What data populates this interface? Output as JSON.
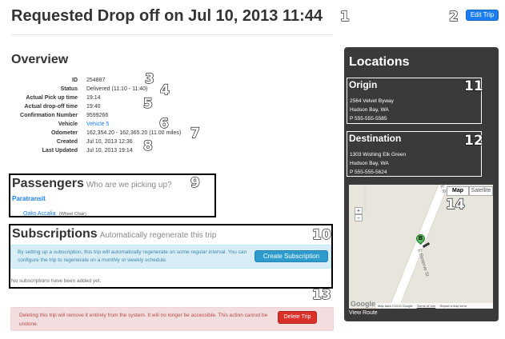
{
  "header": {
    "title": "Requested Drop off on Jul 10, 2013 11:44",
    "edit_trip_label": "Edit Trip"
  },
  "overview": {
    "heading": "Overview",
    "fields": [
      {
        "label": "ID",
        "value": "254887"
      },
      {
        "label": "Status",
        "value": "Delivered (11:10 - 11:40)"
      },
      {
        "label": "Actual Pick up time",
        "value": "19:14"
      },
      {
        "label": "Actual drop-off time",
        "value": "19:40"
      },
      {
        "label": "Confirmation Number",
        "value": "9599266"
      },
      {
        "label": "Vehicle",
        "value": "Vehicle 5"
      },
      {
        "label": "Odometer",
        "value": "162,354.20 - 162,365.20 (11.00 miles)"
      },
      {
        "label": "Created",
        "value": "Jul 10, 2013 12:36"
      },
      {
        "label": "Last Updated",
        "value": "Jul 10, 2013 19:14"
      }
    ]
  },
  "passengers": {
    "heading": "Passengers",
    "subheading": "Who are we picking up?",
    "group": "Paratransit",
    "name": "Oaks Accalia",
    "note": "(Wheel Chair)"
  },
  "subscriptions": {
    "heading": "Subscriptions",
    "subheading": "Automatically regenerate this trip",
    "info": "By setting up a subscription, this trip will automatically regenerate on some regular interval. You can configure the trip to regenerate on a monthly or weekly schedule.",
    "create_label": "Create Subscription",
    "empty_text": "No subscriptions have been added yet."
  },
  "danger": {
    "text": "Deleting this trip will remove it entirely from the system. It will no longer be accessible. This action cannot be undone.",
    "delete_label": "Delete Trip"
  },
  "locations": {
    "heading": "Locations",
    "origin": {
      "heading": "Origin",
      "line1": "2564 Velvet Byway",
      "line2": "Hudson Bay, WA",
      "phone": "P 555-555-5585"
    },
    "destination": {
      "heading": "Destination",
      "line1": "1303 Wishing Elk Green",
      "line2": "Hudson Bay, WA",
      "phone": "P 555-555-5624"
    },
    "map": {
      "map_label": "Map",
      "satellite_label": "Satellite",
      "zoom_in": "+",
      "zoom_out": "−",
      "street_label": "E Reserve St",
      "street_label_top": "E R",
      "marker": "B",
      "google": "Google",
      "attribution": "Map data ©2013 Google",
      "terms": "Terms of Use",
      "report": "Report a map error"
    },
    "view_route_label": "View Route"
  },
  "annotations": [
    "1",
    "2",
    "3",
    "4",
    "5",
    "6",
    "7",
    "8",
    "9",
    "10",
    "11",
    "12",
    "13",
    "14"
  ],
  "colors": {
    "primary": "#1c7ef0",
    "danger": "#d9302a",
    "info_bg": "#d9edf7",
    "danger_bg": "#f2dede",
    "panel": "#3a3a3a"
  }
}
